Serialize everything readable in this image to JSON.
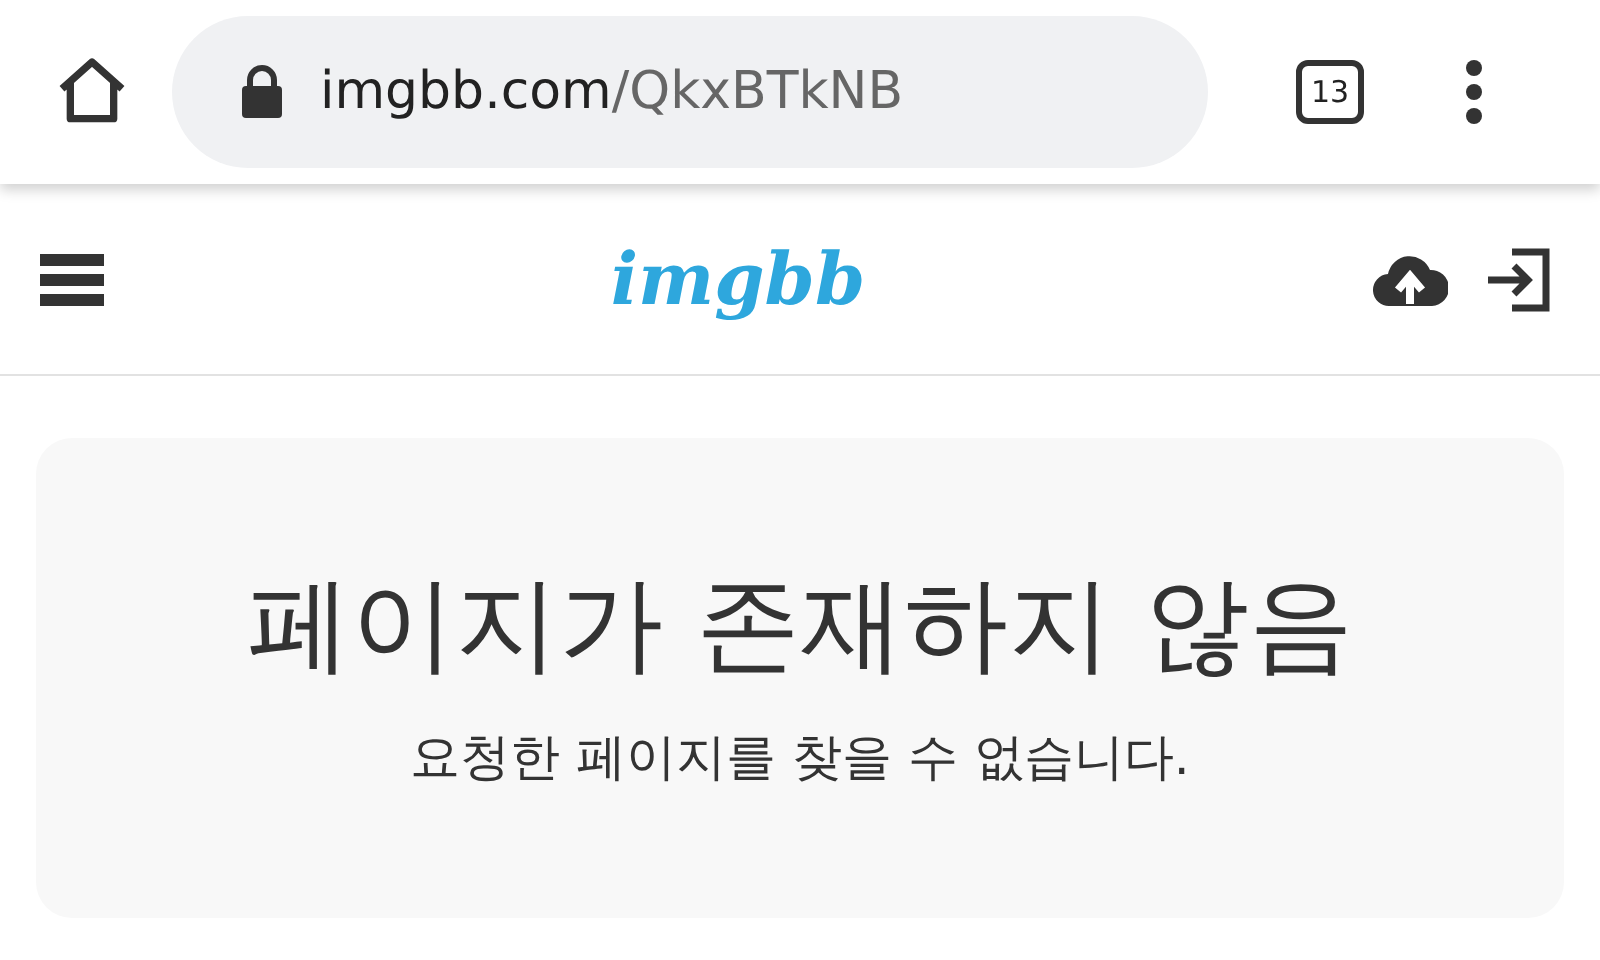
{
  "browser": {
    "url_domain": "imgbb.com",
    "url_path": "/QkxBTkNB",
    "tab_count": "13"
  },
  "header": {
    "logo": "imgbb"
  },
  "message": {
    "title": "페이지가 존재하지 않음",
    "description": "요청한 페이지를 찾을 수 없습니다."
  }
}
